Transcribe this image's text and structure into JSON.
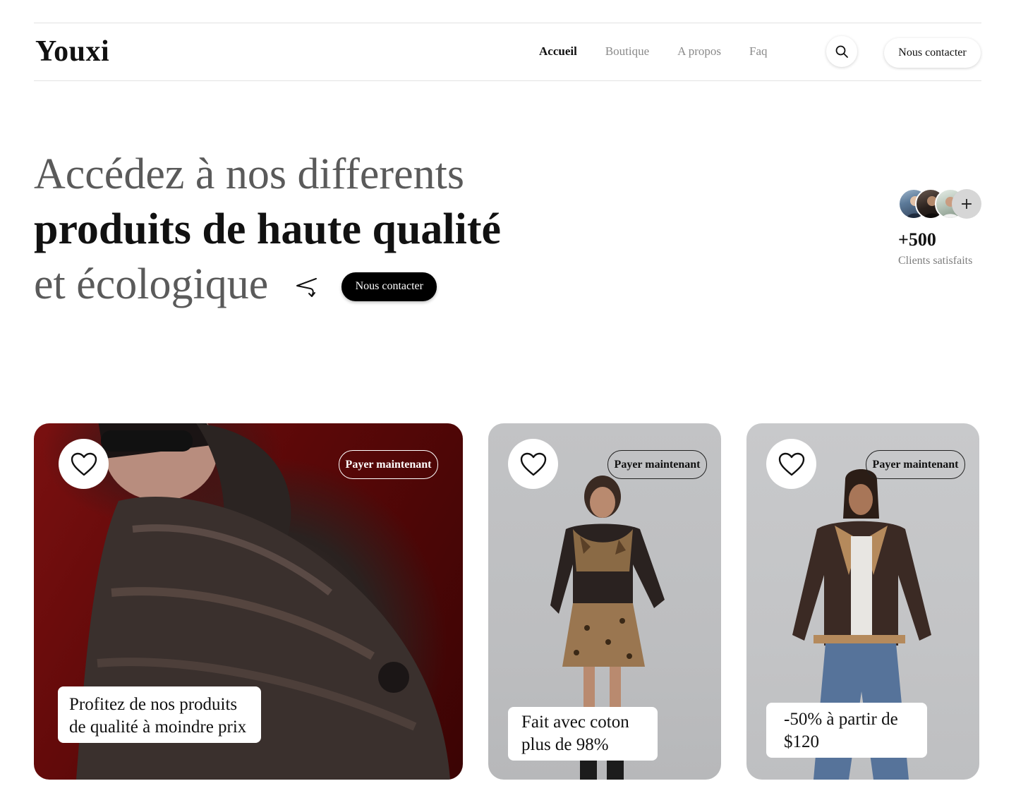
{
  "header": {
    "logo": "Youxi",
    "nav": [
      {
        "label": "Accueil",
        "active": true
      },
      {
        "label": "Boutique",
        "active": false
      },
      {
        "label": "A propos",
        "active": false
      },
      {
        "label": "Faq",
        "active": false
      }
    ],
    "search_icon": "search-icon",
    "contact_label": "Nous contacter"
  },
  "hero": {
    "line1": "Accédez à nos differents",
    "line2": "produits de haute qualité",
    "line3": "et écologique",
    "arrow_icon": "curved-arrow-icon",
    "contact_label": "Nous contacter"
  },
  "clients": {
    "count": "+500",
    "label": "Clients satisfaits",
    "more_symbol": "+"
  },
  "cards": [
    {
      "pay_label": "Payer maintenant",
      "caption": "Profitez de nos produits de qualité à moindre prix",
      "heart_icon": "heart-icon"
    },
    {
      "pay_label": "Payer maintenant",
      "caption": "Fait avec coton plus de 98%",
      "heart_icon": "heart-icon"
    },
    {
      "pay_label": "Payer maintenant",
      "caption": "-50% à partir de $120",
      "heart_icon": "heart-icon"
    }
  ],
  "colors": {
    "primary": "#000000",
    "muted_text": "#5a5a5a",
    "card1_bg": "#5b0808",
    "card_gray": "#c2c3c5"
  }
}
